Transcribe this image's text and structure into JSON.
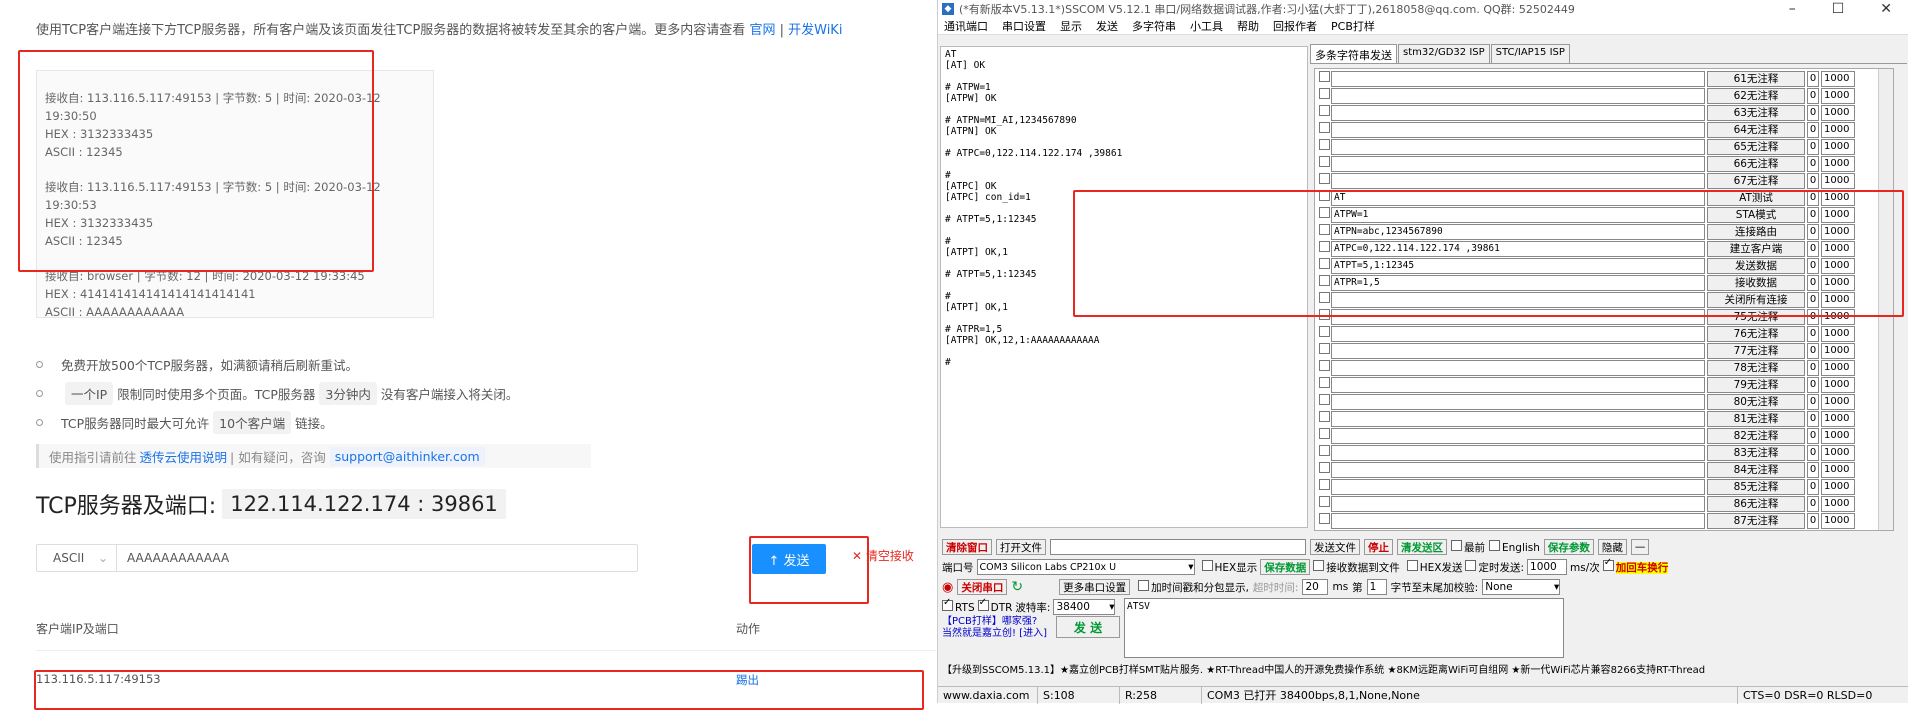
{
  "left": {
    "intro": "使用TCP客户端连接下方TCP服务器，所有客户端及该页面发往TCP服务器的数据将被转发至其余的客户端。更多内容请查看",
    "intro_link1": "官网",
    "intro_sep": "|",
    "intro_link2": "开发WiKi",
    "log": [
      {
        "head": "接收自: 113.116.5.117:49153 | 字节数: 5 | 时间: 2020-03-12 19:30:50",
        "hex": "HEX  : 3132333435",
        "ascii": "ASCII : 12345"
      },
      {
        "head": "接收自: 113.116.5.117:49153 | 字节数: 5 | 时间: 2020-03-12 19:30:53",
        "hex": "HEX  : 3132333435",
        "ascii": "ASCII : 12345"
      },
      {
        "head": "接收自: browser | 字节数: 12 | 时间: 2020-03-12 19:33:45",
        "hex": "HEX  : 414141414141414141414141",
        "ascii": "ASCII : AAAAAAAAAAAA"
      }
    ],
    "notes": [
      {
        "pre": "免费开放500个TCP服务器，如满额请稍后刷新重试。",
        "tag": "",
        "post": ""
      },
      {
        "pre": "",
        "tag": "一个IP",
        "mid": "限制同时使用多个页面。TCP服务器",
        "tag2": "3分钟内",
        "post": "没有客户端接入将关闭。"
      },
      {
        "pre": "TCP服务器同时最大可允许",
        "tag": "10个客户端",
        "post": "链接。"
      }
    ],
    "guide_pre": "使用指引请前往",
    "guide_link": "透传云使用说明",
    "guide_mid": "| 如有疑问，咨询",
    "guide_mail": "support@aithinker.com",
    "tcp_title": "TCP服务器及端口:",
    "tcp_addr": "122.114.122.174 : 39861",
    "format": "ASCII",
    "send_value": "AAAAAAAAAAAA",
    "send_btn": "↑ 发送",
    "clear_btn": "✕ 清空接收",
    "col1": "客户端IP及端口",
    "col2": "动作",
    "client": "113.116.5.117:49153",
    "kick": "踢出"
  },
  "win": {
    "title": "(*有新版本V5.13.1*)SSCOM V5.12.1 串口/网络数据调试器,作者:习小猛(大虾丁丁),2618058@qq.com. QQ群: 52502449",
    "menu": [
      "通讯端口",
      "串口设置",
      "显示",
      "发送",
      "多字符串",
      "小工具",
      "帮助",
      "回报作者",
      "PCB打样"
    ],
    "console": "AT\n[AT] OK\n\n# ATPW=1\n[ATPW] OK\n\n# ATPN=MI_AI,1234567890\n[ATPN] OK\n\n# ATPC=0,122.114.122.174 ,39861\n\n#\n[ATPC] OK\n[ATPC] con_id=1\n\n# ATPT=5,1:12345\n\n#\n[ATPT] OK,1\n\n# ATPT=5,1:12345\n\n#\n[ATPT] OK,1\n\n# ATPR=1,5\n[ATPR] OK,12,1:AAAAAAAAAAAA\n\n#",
    "tabs": [
      "多条字符串发送",
      "stm32/GD32 ISP",
      "STC/IAP15 ISP"
    ],
    "rows": [
      {
        "text": "",
        "btn": "61无注释",
        "n": "0",
        "d": "1000"
      },
      {
        "text": "",
        "btn": "62无注释",
        "n": "0",
        "d": "1000"
      },
      {
        "text": "",
        "btn": "63无注释",
        "n": "0",
        "d": "1000"
      },
      {
        "text": "",
        "btn": "64无注释",
        "n": "0",
        "d": "1000"
      },
      {
        "text": "",
        "btn": "65无注释",
        "n": "0",
        "d": "1000"
      },
      {
        "text": "",
        "btn": "66无注释",
        "n": "0",
        "d": "1000"
      },
      {
        "text": "",
        "btn": "67无注释",
        "n": "0",
        "d": "1000"
      },
      {
        "text": "AT",
        "btn": "AT测试",
        "n": "0",
        "d": "1000"
      },
      {
        "text": "ATPW=1",
        "btn": "STA模式",
        "n": "0",
        "d": "1000"
      },
      {
        "text": "ATPN=abc,1234567890",
        "btn": "连接路由",
        "n": "0",
        "d": "1000"
      },
      {
        "text": "ATPC=0,122.114.122.174 ,39861",
        "btn": "建立客户端",
        "n": "0",
        "d": "1000"
      },
      {
        "text": "ATPT=5,1:12345",
        "btn": "发送数据",
        "n": "0",
        "d": "1000"
      },
      {
        "text": "ATPR=1,5",
        "btn": "接收数据",
        "n": "0",
        "d": "1000"
      },
      {
        "text": "",
        "btn": "关闭所有连接",
        "n": "0",
        "d": "1000"
      },
      {
        "text": "",
        "btn": "75无注释",
        "n": "0",
        "d": "1000"
      },
      {
        "text": "",
        "btn": "76无注释",
        "n": "0",
        "d": "1000"
      },
      {
        "text": "",
        "btn": "77无注释",
        "n": "0",
        "d": "1000"
      },
      {
        "text": "",
        "btn": "78无注释",
        "n": "0",
        "d": "1000"
      },
      {
        "text": "",
        "btn": "79无注释",
        "n": "0",
        "d": "1000"
      },
      {
        "text": "",
        "btn": "80无注释",
        "n": "0",
        "d": "1000"
      },
      {
        "text": "",
        "btn": "81无注释",
        "n": "0",
        "d": "1000"
      },
      {
        "text": "",
        "btn": "82无注释",
        "n": "0",
        "d": "1000"
      },
      {
        "text": "",
        "btn": "83无注释",
        "n": "0",
        "d": "1000"
      },
      {
        "text": "",
        "btn": "84无注释",
        "n": "0",
        "d": "1000"
      },
      {
        "text": "",
        "btn": "85无注释",
        "n": "0",
        "d": "1000"
      },
      {
        "text": "",
        "btn": "86无注释",
        "n": "0",
        "d": "1000"
      },
      {
        "text": "",
        "btn": "87无注释",
        "n": "0",
        "d": "1000"
      }
    ],
    "clear_window": "清除窗口",
    "open_file": "打开文件",
    "send_file": "发送文件",
    "stop": "停止",
    "clear_send": "清发送区",
    "top": "最前",
    "english": "English",
    "save_params": "保存参数",
    "hide": "隐藏",
    "port_label": "端口号",
    "port_value": "COM3 Silicon Labs CP210x U",
    "hex_show": "HEX显示",
    "save_data": "保存数据",
    "recv_to_file": "接收数据到文件",
    "hex_send": "HEX发送",
    "timed_send": "定时发送:",
    "interval": "1000",
    "interval_unit": "ms/次",
    "crlf": "加回车换行",
    "close_port": "关闭串口",
    "more_settings": "更多串口设置",
    "timestamp": "加时间戳和分包显示,",
    "timeout_label": "超时时间:",
    "timeout": "20",
    "timeout_unit": "ms",
    "page_label": "第",
    "page": "1",
    "byte_to_end": "字节至末尾加校验:",
    "checksum": "None",
    "rts": "RTS",
    "dtr": "DTR",
    "baud_label": "波特率:",
    "baud": "38400",
    "send_area": "ATSV",
    "pcb_line1": "【PCB打样】哪家强?",
    "pcb_line2": "当然就是嘉立创! [进入]",
    "send": "发 送",
    "ticker": "【升级到SSCOM5.13.1】★嘉立创PCB打样SMT贴片服务. ★RT-Thread中国人的开源免费操作系统 ★8KM远距离WiFi可自组网 ★新一代WiFi芯片兼容8266支持RT-Thread",
    "status": [
      "www.daxia.com",
      "S:108",
      "R:258",
      "COM3 已打开  38400bps,8,1,None,None",
      "CTS=0 DSR=0 RLSD=0"
    ]
  }
}
